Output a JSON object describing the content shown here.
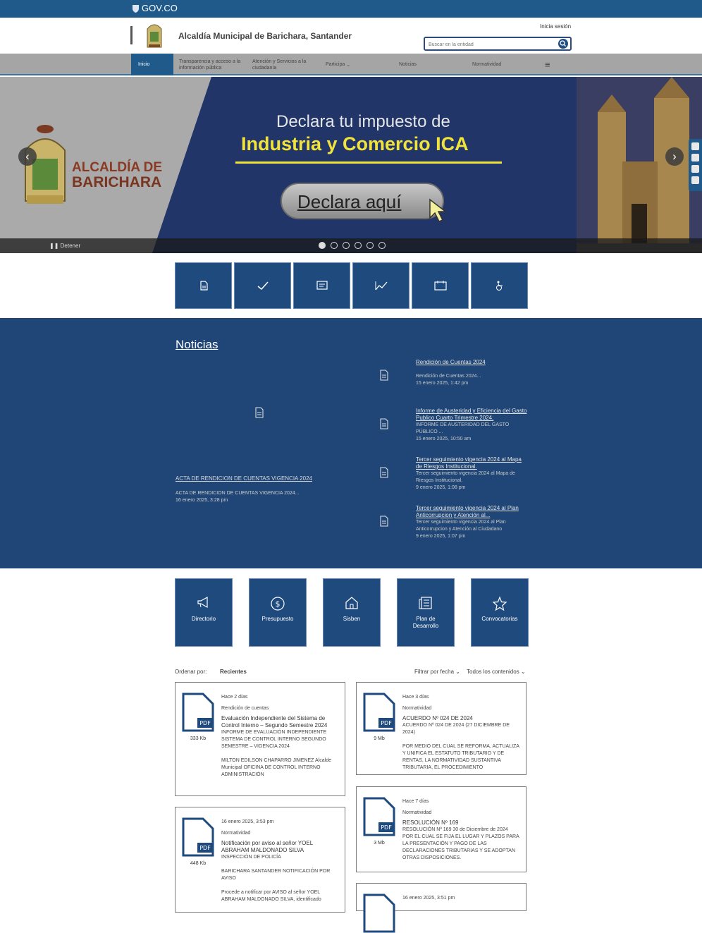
{
  "gov": {
    "logo_text": "GOV.CO"
  },
  "header": {
    "title": "Alcaldía Municipal de Barichara, Santander",
    "login": "Inicia sesión",
    "search_placeholder": "Buscar en la entidad"
  },
  "nav": {
    "items": [
      "Inicio",
      "Transparencia y acceso a la información pública",
      "Atención y Servicios a la ciudadanía",
      "Participa",
      "Noticias",
      "Normatividad"
    ]
  },
  "hero": {
    "brand_line1": "ALCALDÍA DE",
    "brand_line2": "BARICHARA",
    "headline1": "Declara tu impuesto de",
    "headline2": "Industria y Comercio ICA",
    "cta": "Declara aquí",
    "stop": "Detener",
    "slides": 6,
    "active_slide": 1
  },
  "news": {
    "heading": "Noticias",
    "main": {
      "title": "ACTA DE RENDICION DE CUENTAS VIGENCIA 2024",
      "desc": "ACTA DE RENDICION DE CUENTAS VIGENCIA 2024...",
      "date": "16 enero 2025, 3:28 pm"
    },
    "items": [
      {
        "title": "Rendición de Cuentas 2024",
        "desc": "Rendición de Cuentas 2024...",
        "date": "15 enero 2025, 1:42 pm"
      },
      {
        "title": "Informe de Austeridad y Eficiencia del Gasto Publico Cuarto Trimestre 2024.",
        "desc": "INFORME DE AUSTERIDAD DEL GASTO PÚBLICO ...",
        "date": "15 enero 2025, 10:50 am"
      },
      {
        "title": "Tercer seguimiento vigencia 2024 al Mapa de Riesgos Institucional.",
        "desc": "Tercer seguimiento vigencia 2024 al Mapa de Riesgos Institucional.",
        "date": "9 enero 2025, 1:08 pm"
      },
      {
        "title": "Tercer seguimiento vigencia 2024 al Plan Anticorrupcion y Atención al...",
        "desc": "Tercer seguimiento vigencia 2024 al Plan Anticorrupcion y Atención al Ciudadano",
        "date": "9 enero 2025, 1:07 pm"
      }
    ]
  },
  "quick": [
    "Directorio",
    "Presupuesto",
    "Sisben",
    "Plan de Desarrollo",
    "Convocatorias"
  ],
  "sort": {
    "label": "Ordenar por:",
    "value": "Recientes",
    "filter_date": "Filtrar por fecha",
    "filter_content": "Todos los contenidos"
  },
  "cards": [
    {
      "size": "333 Kb",
      "ago": "Hace 2 días",
      "category": "Rendición de cuentas",
      "title": "Evaluación Independiente del Sistema de Control Interno – Segundo Semestre 2024",
      "body1": "INFORME DE EVALUACIÓN INDEPENDIENTE SISTEMA DE CONTROL INTERNO SEGUNDO SEMESTRE – VIGENCIA 2024",
      "body2": "MILTON EDILSON CHAPARRO JIMENEZ Alcalde Municipal OFICINA DE CONTROL INTERNO ADMINISTRACIÓN"
    },
    {
      "size": "9 Mb",
      "ago": "Hace 3 días",
      "category": "Normatividad",
      "title": "ACUERDO Nº 024 DE 2024",
      "body1": "ACUERDO Nº 024 DE 2024 (27 DICIEMBRE DE 2024)",
      "body2": "POR MEDIO DEL CUAL SE REFORMA, ACTUALIZA Y UNIFICA EL ESTATUTO TRIBUTARIO Y DE RENTAS, LA NORMATIVIDAD SUSTANTIVA TRIBUTARIA, EL PROCEDIMIENTO"
    },
    {
      "size": "448 Kb",
      "ago": "16 enero 2025, 3:53 pm",
      "category": "Normatividad",
      "title": "Notificación por aviso al señor YOEL ABRAHAM MALDONADO SILVA",
      "body1": "INSPECCIÓN DE POLICÍA",
      "body2": "BARICHARA SANTANDER NOTIFICACIÓN POR AVISO",
      "body3": "Procede a notificar por AVISO al señor YOEL ABRAHAM MALDONADO SILVA, identificado"
    },
    {
      "size": "3 Mb",
      "ago": "Hace 7 días",
      "category": "Normatividad",
      "title": "RESOLUCIÓN Nº 169",
      "body1": "RESOLUCIÓN Nº 169 30 de Diciembre de 2024",
      "body2": "POR EL CUAL SE FIJA EL LUGAR Y PLAZOS PARA LA PRESENTACIÓN Y PAGO DE LAS DECLARACIONES TRIBUTARIAS Y SE ADOPTAN OTRAS DISPOSICIONES."
    },
    {
      "ago": "16 enero 2025, 3:51 pm"
    }
  ],
  "colors": {
    "brand_blue": "#1f4677",
    "gov_blue": "#1f5a8a",
    "accent_yellow": "#f2e33a"
  }
}
